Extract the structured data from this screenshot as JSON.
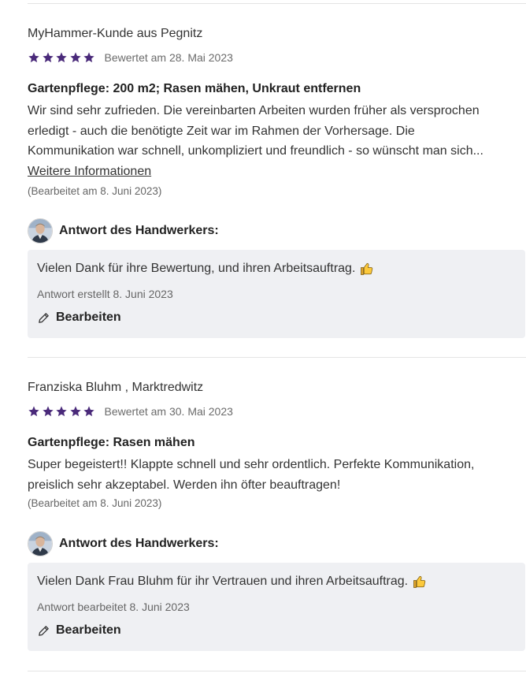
{
  "reviews": [
    {
      "reviewer": "MyHammer-Kunde aus Pegnitz",
      "rating": 5,
      "rated_date": "Bewertet am 28. Mai 2023",
      "title": "Gartenpflege: 200 m2; Rasen mähen, Unkraut entfernen",
      "body_lines": [
        "Wir sind sehr zufrieden. Die vereinbarten Arbeiten wurden früher als versprochen",
        "erledigt - auch die benötigte Zeit war im Rahmen der Vorhersage. Die",
        "Kommunikation war schnell, unkompliziert und freundlich - so wünscht man sich..."
      ],
      "more_link": "Weitere Informationen",
      "edited_note": "(Bearbeitet am 8. Juni 2023)",
      "response": {
        "label": "Antwort des Handwerkers:",
        "text": "Vielen Dank für ihre Bewertung, und ihren Arbeitsauftrag.",
        "date": "Antwort erstellt 8. Juni 2023",
        "edit_label": "Bearbeiten"
      }
    },
    {
      "reviewer": "Franziska Bluhm , Marktredwitz",
      "rating": 5,
      "rated_date": "Bewertet am 30. Mai 2023",
      "title": "Gartenpflege: Rasen mähen",
      "body_lines": [
        "Super begeistert!! Klappte schnell und sehr ordentlich. Perfekte Kommunikation,",
        "preislich sehr akzeptabel. Werden ihn öfter beauftragen!"
      ],
      "edited_note": "(Bearbeitet am 8. Juni 2023)",
      "response": {
        "label": "Antwort des Handwerkers:",
        "text": "Vielen Dank Frau Bluhm für ihr Vertrauen und ihren Arbeitsauftrag.",
        "date": "Antwort bearbeitet 8. Juni 2023",
        "edit_label": "Bearbeiten"
      }
    }
  ],
  "colors": {
    "star": "#4a2a7a",
    "response_bg": "#eff0f3",
    "divider": "#e4e4e4"
  },
  "icons": {
    "star": "star-icon",
    "thumb": "thumbs-up-icon",
    "edit": "pencil-icon",
    "avatar": "avatar"
  }
}
